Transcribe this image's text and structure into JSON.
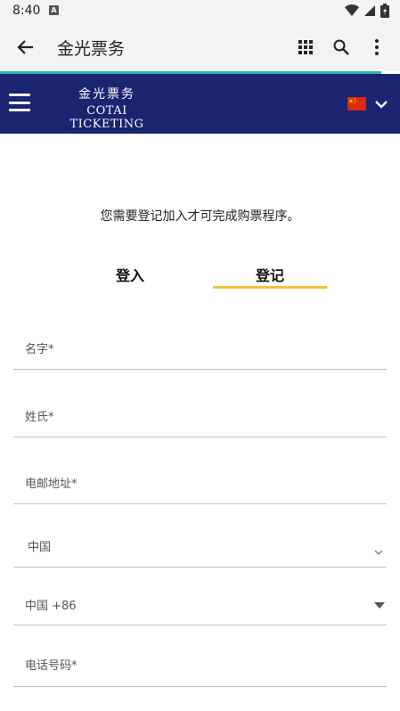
{
  "status_bar": {
    "time": "8:40",
    "notification_glyph": "A"
  },
  "app_bar": {
    "title": "金光票务"
  },
  "header": {
    "logo_cn": "金光票务",
    "logo_en": "COTAI TICKETING"
  },
  "main": {
    "prompt": "您需要登记加入才可完成购票程序。",
    "tabs": [
      {
        "label": "登入",
        "active": false
      },
      {
        "label": "登记",
        "active": true
      }
    ],
    "form": {
      "first_name_label": "名字*",
      "last_name_label": "姓氏*",
      "email_label": "电邮地址*",
      "country_value": "中国",
      "phone_code_value": "中国 +86",
      "phone_label": "电话号码*"
    }
  },
  "colors": {
    "header_bg": "#1a2470",
    "accent_teal": "#2bb5a8",
    "active_tab_underline": "#f0c23a",
    "flag_red": "#de2910",
    "flag_star": "#ffde00"
  },
  "icons": [
    "back-arrow-icon",
    "apps-grid-icon",
    "search-icon",
    "more-vert-icon",
    "menu-icon",
    "china-flag-icon",
    "chevron-down-icon",
    "wifi-icon",
    "signal-icon",
    "battery-icon"
  ]
}
